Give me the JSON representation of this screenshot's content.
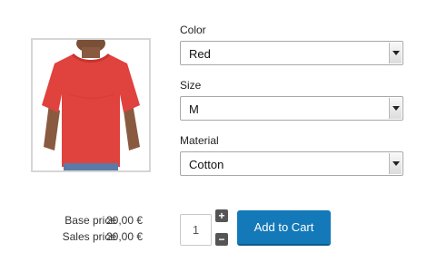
{
  "product": {
    "image_icon": "red-tshirt-photo",
    "options": [
      {
        "label": "Color",
        "value": "Red"
      },
      {
        "label": "Size",
        "value": "M"
      },
      {
        "label": "Material",
        "value": "Cotton"
      }
    ]
  },
  "prices": {
    "base_label": "Base price",
    "base_value": "20,00 €",
    "sales_label": "Sales price",
    "sales_value": "20,00 €"
  },
  "cart": {
    "quantity": "1",
    "increase_symbol": "+",
    "decrease_symbol": "−",
    "add_to_cart_label": "Add to Cart",
    "button_color": "#1479b8"
  }
}
